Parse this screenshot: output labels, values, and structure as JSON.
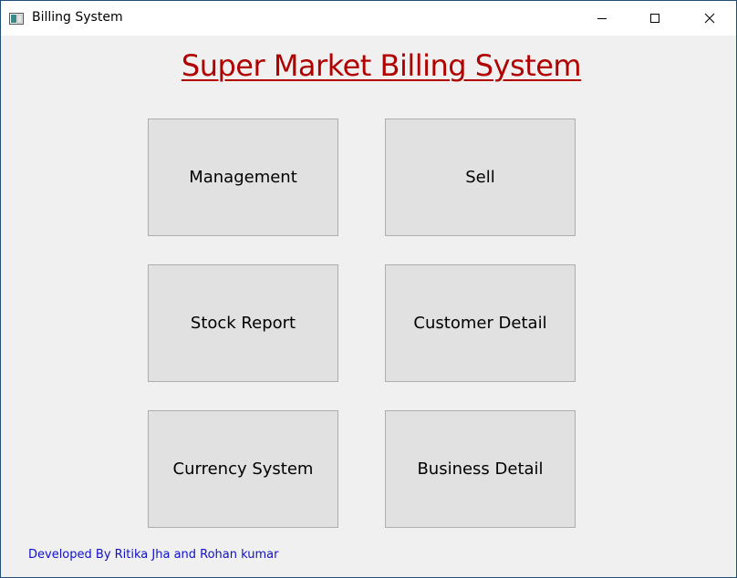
{
  "window": {
    "title": "Billing System",
    "controls": {
      "minimize_icon": "minimize-icon",
      "maximize_icon": "maximize-icon",
      "close_icon": "close-icon"
    }
  },
  "main": {
    "heading": "Super Market Billing System",
    "buttons": [
      {
        "label": "Management"
      },
      {
        "label": "Sell"
      },
      {
        "label": "Stock Report"
      },
      {
        "label": "Customer Detail"
      },
      {
        "label": "Currency System"
      },
      {
        "label": "Business Detail"
      }
    ],
    "footer": "Developed By Ritika Jha and Rohan kumar"
  },
  "colors": {
    "heading": "#b00000",
    "footer": "#1010cc",
    "button_bg": "#e1e1e1",
    "window_bg": "#f0f0f0"
  }
}
